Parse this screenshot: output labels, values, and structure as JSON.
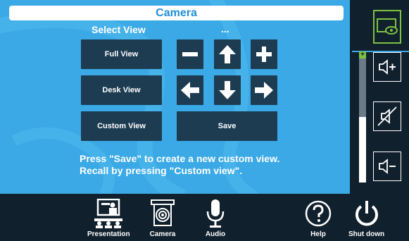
{
  "header": {
    "title": "Camera"
  },
  "camera": {
    "select_view_label": "Select View",
    "current_view": "...",
    "views": {
      "full": "Full View",
      "desk": "Desk View",
      "custom": "Custom View"
    },
    "save_label": "Save",
    "info_line1": "Press \"Save\" to create a new custom view.",
    "info_line2": "Recall by pressing \"Custom view\".",
    "controls": [
      "zoom-out-icon",
      "arrow-up-icon",
      "zoom-in-icon",
      "arrow-left-icon",
      "arrow-down-icon",
      "arrow-right-icon"
    ]
  },
  "audio_panel": {
    "volume_level": 0.5,
    "meter_plus": "+",
    "buttons": [
      "volume-up-icon",
      "mute-icon",
      "volume-down-icon"
    ]
  },
  "nav": {
    "items": [
      {
        "label": "Presentation",
        "icon": "presentation-icon"
      },
      {
        "label": "Camera",
        "icon": "camera-icon"
      },
      {
        "label": "Audio",
        "icon": "microphone-icon"
      },
      {
        "label": "Help",
        "icon": "help-icon"
      },
      {
        "label": "Shut down",
        "icon": "power-icon"
      }
    ]
  },
  "colors": {
    "main_bg": "#3aa9e6",
    "dark": "#1d3c52",
    "panel": "#11202d",
    "accent": "#7dc242",
    "title": "#1f8fd8"
  }
}
